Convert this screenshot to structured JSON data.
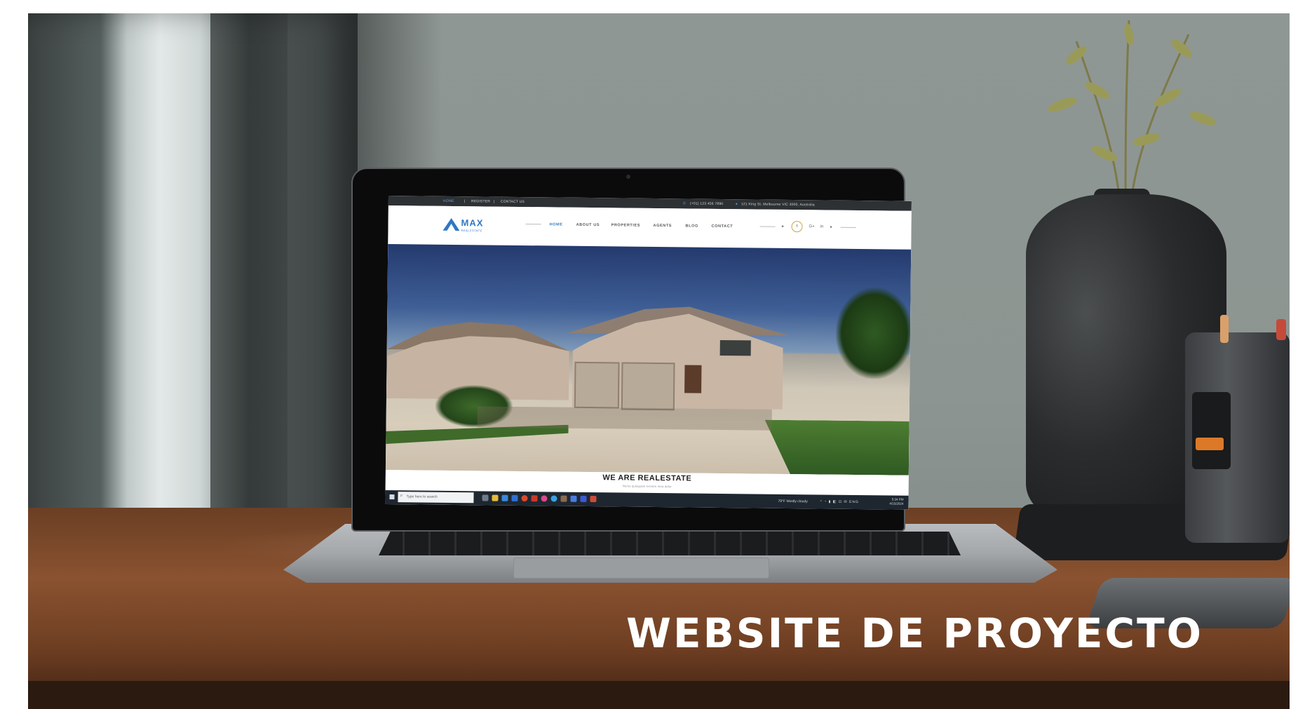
{
  "caption": "WEBSITE DE PROYECTO",
  "website": {
    "topbar": {
      "links": [
        "HOME",
        "REGISTER",
        "CONTACT US"
      ],
      "phone": "(+01) 123 456 7890",
      "address": "121 King St, Melbourne VIC 3000, Australia"
    },
    "logo": {
      "name": "MAX",
      "tagline": "REALESTATE"
    },
    "nav": [
      "HOME",
      "ABOUT US",
      "PROPERTIES",
      "AGENTS",
      "BLOG",
      "CONTACT"
    ],
    "hero": {
      "heading": "WE ARE REALESTATE",
      "subheading": "Nemo quisquam evenire mea dolor"
    },
    "taskbar": {
      "search_placeholder": "Type here to search",
      "weather": "79°F  Mostly cloudy",
      "time": "5:34 PM",
      "date": "4/15/2024"
    }
  },
  "colors": {
    "brand": "#2f78c4",
    "topbar": "#2e3134",
    "taskbar": "#1e2730",
    "caption": "#ffffff"
  }
}
